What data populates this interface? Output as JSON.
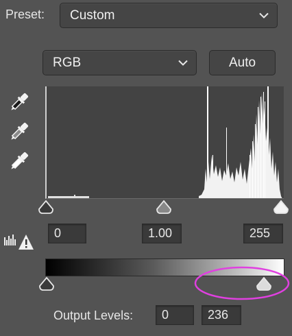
{
  "preset": {
    "label": "Preset:",
    "value": "Custom"
  },
  "channel": {
    "value": "RGB"
  },
  "auto_button": {
    "label": "Auto"
  },
  "input_levels": {
    "black": "0",
    "gamma": "1.00",
    "white": "255"
  },
  "output_levels": {
    "label": "Output Levels:",
    "black": "0",
    "white": "236"
  },
  "icons": {
    "eyedroppers": [
      "black-point-eyedropper-icon",
      "gray-point-eyedropper-icon",
      "white-point-eyedropper-icon"
    ],
    "warning": "histogram-clipping-warning-icon",
    "slider_handle": "triangle-slider-handle-icon"
  },
  "colors": {
    "panel_bg": "#535353",
    "histogram_bg": "#434343",
    "highlight_circle": "#e040e0"
  }
}
